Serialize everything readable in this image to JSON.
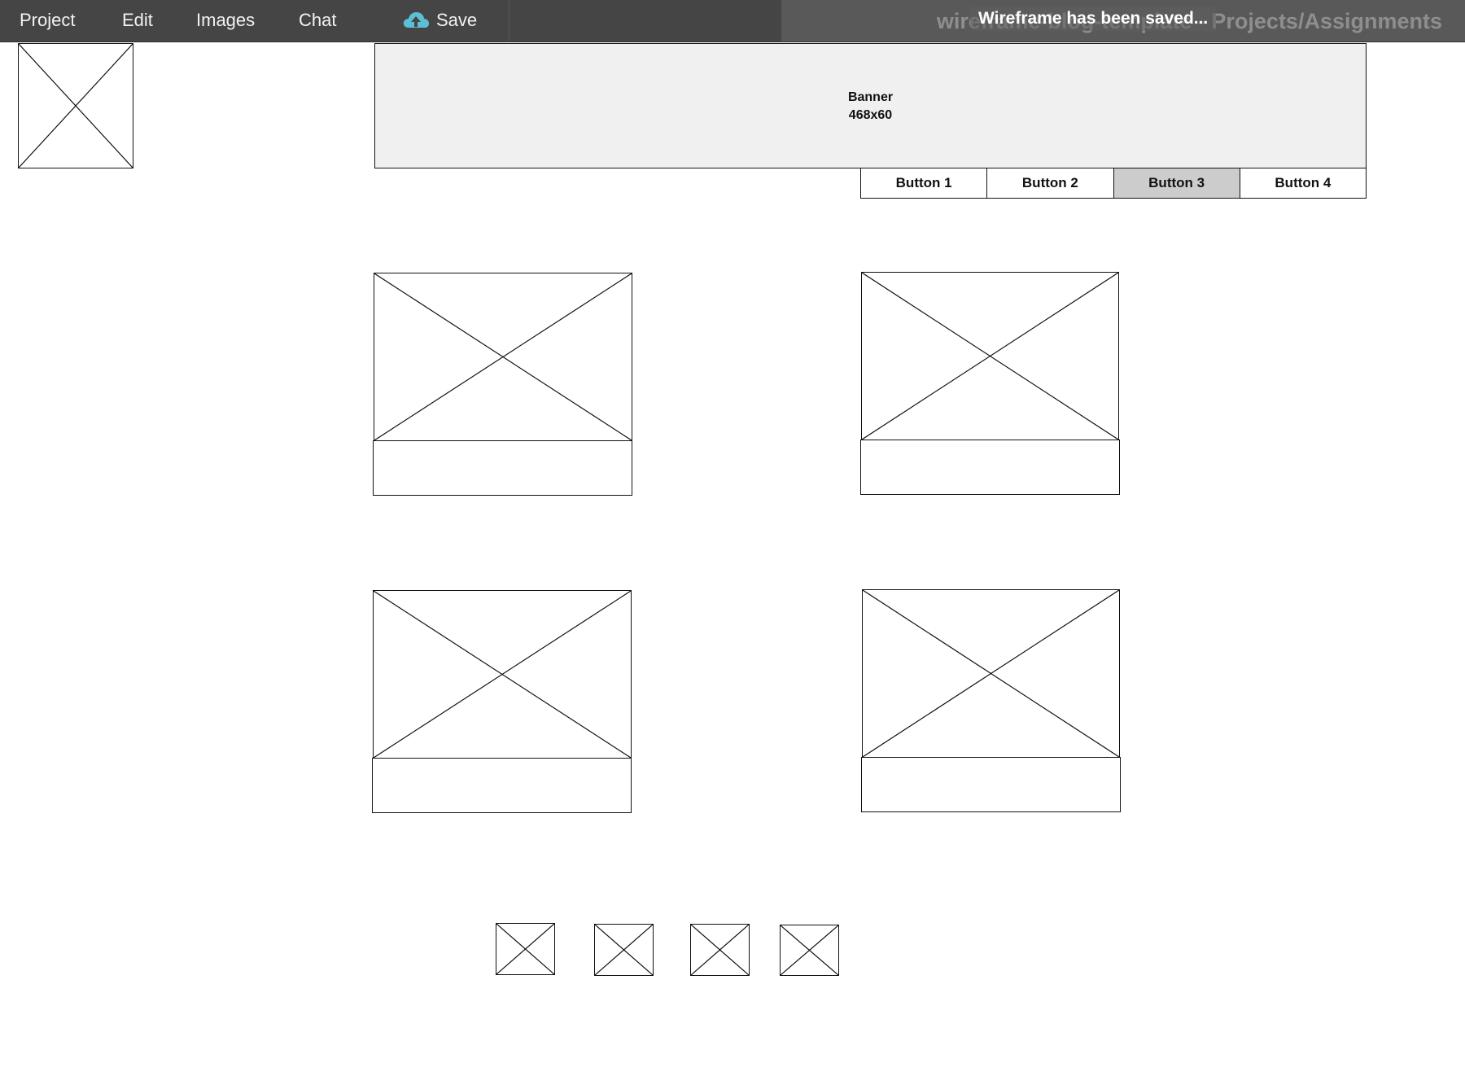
{
  "menu": {
    "items": [
      {
        "label": "Project"
      },
      {
        "label": "Edit"
      },
      {
        "label": "Images"
      },
      {
        "label": "Chat"
      }
    ],
    "save_label": "Save",
    "save_icon": "cloud-upload-icon"
  },
  "title_bar": {
    "title": "wireframe-blog-template - Projects/Assignments",
    "toast": "Wireframe has been saved..."
  },
  "banner": {
    "line1": "Banner",
    "line2": "468x60"
  },
  "button_bar": {
    "buttons": [
      {
        "label": "Button 1",
        "active": false
      },
      {
        "label": "Button 2",
        "active": false
      },
      {
        "label": "Button 3",
        "active": true
      },
      {
        "label": "Button 4",
        "active": false
      }
    ]
  },
  "colors": {
    "menubar_bg": "#454545",
    "cloud_icon": "#5bbfd6",
    "banner_bg": "#f0f0f0",
    "active_button_bg": "#cccccc"
  }
}
